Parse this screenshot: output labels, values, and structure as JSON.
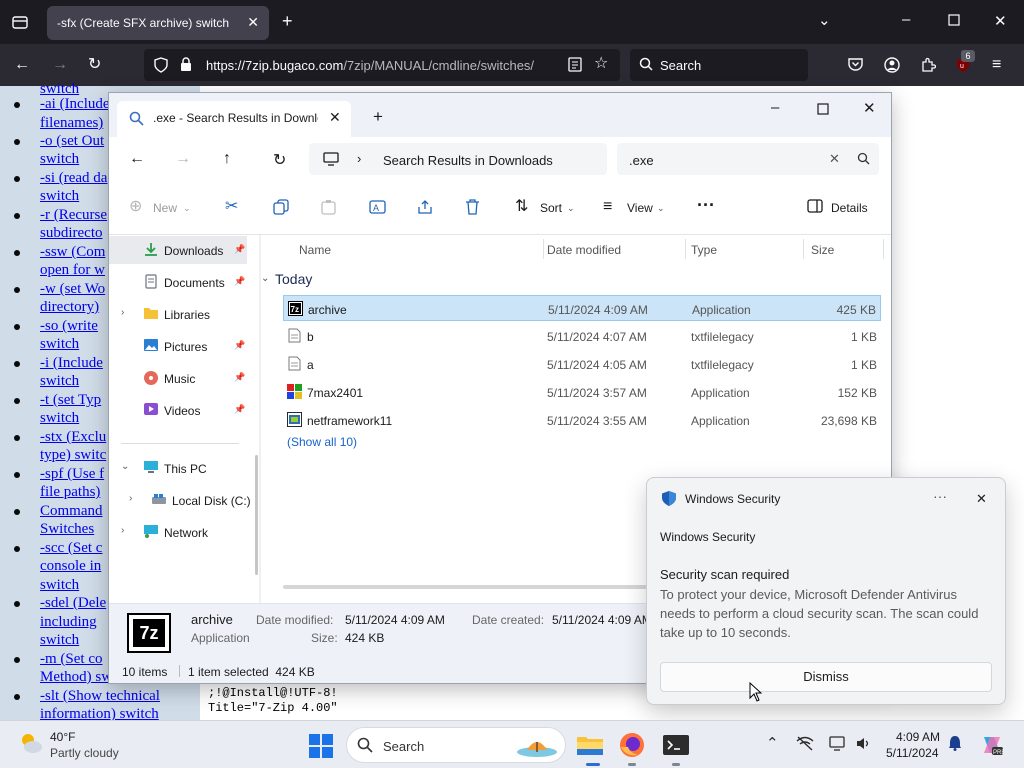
{
  "browser": {
    "tab_title": "-sfx (Create SFX archive) switch",
    "url_domain": "https://7zip.bugaco.com",
    "url_path": "/7zip/MANUAL/cmdline/switches/",
    "search_placeholder": "Search",
    "extensions_badge": "6"
  },
  "page": {
    "nav_links": [
      "switch",
      "-ai (Include",
      "filenames)",
      "-o (set Out",
      "switch",
      "-si (read da",
      "switch",
      "-r (Recurse",
      "subdirecto",
      "-ssw (Com",
      "open for w",
      "-w (set Wo",
      "directory)",
      "-so (write",
      "switch",
      "-i (Include",
      "switch",
      "-t (set Typ",
      "switch",
      "-stx (Exclu",
      "type) switc",
      "-spf (Use f",
      "file paths)",
      "Command",
      "Switches",
      "-scc (Set c",
      "console in",
      "switch",
      "-sdel (Dele",
      "including",
      "switch",
      "-m (Set co",
      "Method) sw",
      "-slt (Show technical",
      "information) switch"
    ],
    "code_lines": [
      ";!@Install@!UTF-8!",
      "Title=\"7-Zip 4.00\""
    ]
  },
  "explorer": {
    "tab_title": ".exe - Search Results in Downloads",
    "breadcrumb": "Search Results in Downloads",
    "search_value": ".exe",
    "toolbar": {
      "new_label": "New",
      "sort_label": "Sort",
      "view_label": "View",
      "details_label": "Details"
    },
    "sidebar": [
      {
        "label": "Downloads",
        "icon": "download-icon",
        "pinned": true
      },
      {
        "label": "Documents",
        "icon": "document-icon",
        "pinned": true
      },
      {
        "label": "Libraries",
        "icon": "folder-icon",
        "pinned": false
      },
      {
        "label": "Pictures",
        "icon": "picture-icon",
        "pinned": true
      },
      {
        "label": "Music",
        "icon": "music-icon",
        "pinned": true
      },
      {
        "label": "Videos",
        "icon": "video-icon",
        "pinned": true
      },
      {
        "label": "This PC",
        "icon": "pc-icon",
        "pinned": false
      },
      {
        "label": "Local Disk (C:)",
        "icon": "disk-icon",
        "pinned": false
      },
      {
        "label": "Network",
        "icon": "network-icon",
        "pinned": false
      }
    ],
    "columns": [
      "Name",
      "Date modified",
      "Type",
      "Size"
    ],
    "group": "Today",
    "files": [
      {
        "name": "archive",
        "date": "5/11/2024 4:09 AM",
        "type": "Application",
        "size": "425 KB",
        "selected": true
      },
      {
        "name": "b",
        "date": "5/11/2024 4:07 AM",
        "type": "txtfilelegacy",
        "size": "1 KB"
      },
      {
        "name": "a",
        "date": "5/11/2024 4:05 AM",
        "type": "txtfilelegacy",
        "size": "1 KB"
      },
      {
        "name": "7max2401",
        "date": "5/11/2024 3:57 AM",
        "type": "Application",
        "size": "152 KB"
      },
      {
        "name": "netframework11",
        "date": "5/11/2024 3:55 AM",
        "type": "Application",
        "size": "23,698 KB"
      }
    ],
    "show_all": "(Show all 10)",
    "details": {
      "name": "archive",
      "type": "Application",
      "date_modified_label": "Date modified:",
      "date_modified": "5/11/2024 4:09 AM",
      "size_label": "Size:",
      "size": "424 KB",
      "date_created_label": "Date created:",
      "date_created": "5/11/2024 4:09 AM"
    },
    "status": {
      "items": "10 items",
      "selection": "1 item selected  424 KB"
    }
  },
  "toast": {
    "app_name": "Windows Security",
    "heading": "Windows Security",
    "title": "Security scan required",
    "body": "To protect your device, Microsoft Defender Antivirus needs to perform a cloud security scan. The scan could take up to 10 seconds.",
    "dismiss_label": "Dismiss"
  },
  "taskbar": {
    "weather_temp": "40°F",
    "weather_desc": "Partly cloudy",
    "search_placeholder": "Search",
    "time": "4:09 AM",
    "date": "5/11/2024"
  }
}
